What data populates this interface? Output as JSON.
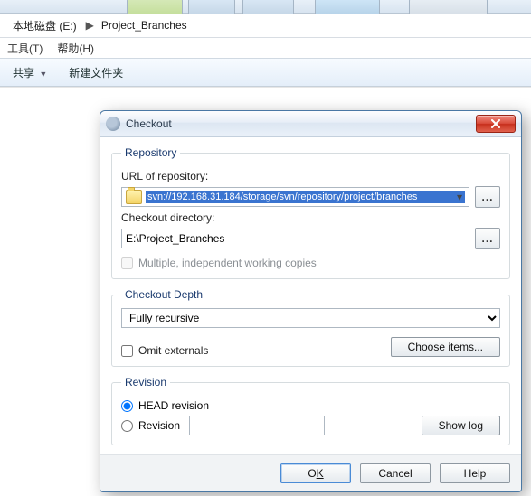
{
  "breadcrumb": {
    "seg1": "本地磁盘 (E:)",
    "seg2": "Project_Branches"
  },
  "menubar": {
    "tools": "工具(T)",
    "help": "帮助(H)"
  },
  "toolbar": {
    "share": "共享",
    "newfolder": "新建文件夹"
  },
  "dialog": {
    "title": "Checkout",
    "repo": {
      "legend": "Repository",
      "url_label": "URL of repository:",
      "url_value": "svn://192.168.31.184/storage/svn/repository/project/branches",
      "dir_label": "Checkout directory:",
      "dir_value": "E:\\Project_Branches",
      "multi_label": "Multiple, independent working copies",
      "browse": "..."
    },
    "depth": {
      "legend": "Checkout Depth",
      "value": "Fully recursive",
      "omit_label": "Omit externals",
      "choose": "Choose items..."
    },
    "rev": {
      "legend": "Revision",
      "head": "HEAD revision",
      "rev": "Revision",
      "rev_value": "",
      "showlog": "Show log"
    },
    "buttons": {
      "ok_pre": "O",
      "ok_u": "K",
      "cancel": "Cancel",
      "help": "Help"
    }
  }
}
